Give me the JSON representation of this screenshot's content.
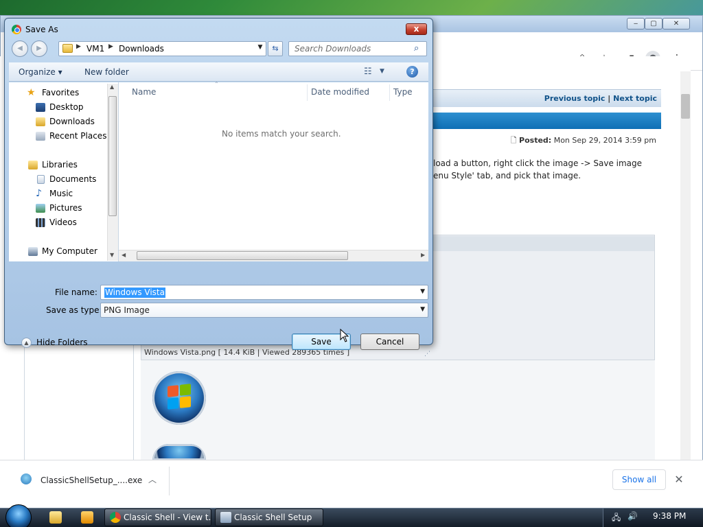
{
  "browser": {
    "topic_nav": {
      "previous": "Previous topic",
      "separator": "|",
      "next": "Next topic"
    },
    "posted_label": "Posted:",
    "posted_date": "Mon Sep 29, 2014 3:59 pm",
    "post_lines": [
      "load a button, right click the image -> Save image",
      "enu Style' tab, and pick that image."
    ],
    "attachment_caption": "Windows Vista.png [ 14.4 KiB | Viewed 289365 times ]"
  },
  "downloads_shelf": {
    "file_name": "ClassicShellSetup_....exe",
    "show_all": "Show all",
    "close": "✕"
  },
  "taskbar": {
    "tasks": [
      {
        "label": "Classic Shell - View t..."
      },
      {
        "label": "Classic Shell Setup"
      }
    ],
    "clock": "9:38 PM"
  },
  "dialog": {
    "title": "Save As",
    "close_label": "x",
    "breadcrumb": [
      "VM1",
      "Downloads"
    ],
    "search_placeholder": "Search Downloads",
    "toolbar": {
      "organize": "Organize ▾",
      "new_folder": "New folder",
      "help": "?"
    },
    "nav": {
      "favorites": {
        "label": "Favorites",
        "items": [
          "Desktop",
          "Downloads",
          "Recent Places"
        ]
      },
      "libraries": {
        "label": "Libraries",
        "items": [
          "Documents",
          "Music",
          "Pictures",
          "Videos"
        ]
      },
      "computer": {
        "label": "My Computer"
      }
    },
    "columns": [
      "Name",
      "Date modified",
      "Type"
    ],
    "empty_message": "No items match your search.",
    "file_name_label": "File name:",
    "file_name_value": "Windows Vista",
    "save_as_type_label": "Save as type:",
    "save_as_type_value": "PNG Image",
    "hide_folders": "Hide Folders",
    "save_button": "Save",
    "cancel_button": "Cancel"
  },
  "colors": {
    "link_blue": "#105289",
    "selection": "#3399ff",
    "chrome_link": "#1a73e8"
  }
}
